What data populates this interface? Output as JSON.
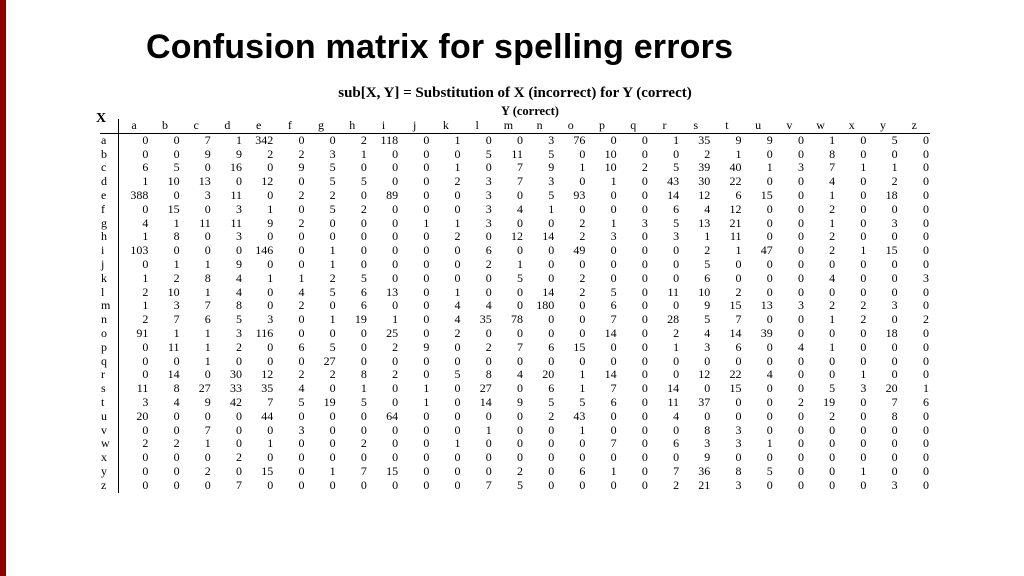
{
  "title": "Confusion matrix for spelling errors",
  "caption": "sub[X, Y] = Substitution of X (incorrect) for Y (correct)",
  "y_axis_label": "Y (correct)",
  "x_axis_label": "X",
  "letters": [
    "a",
    "b",
    "c",
    "d",
    "e",
    "f",
    "g",
    "h",
    "i",
    "j",
    "k",
    "l",
    "m",
    "n",
    "o",
    "p",
    "q",
    "r",
    "s",
    "t",
    "u",
    "v",
    "w",
    "x",
    "y",
    "z"
  ],
  "chart_data": {
    "type": "table",
    "title": "Confusion matrix for spelling errors — sub[X,Y]",
    "row_labels": [
      "a",
      "b",
      "c",
      "d",
      "e",
      "f",
      "g",
      "h",
      "i",
      "j",
      "k",
      "l",
      "m",
      "n",
      "o",
      "p",
      "q",
      "r",
      "s",
      "t",
      "u",
      "v",
      "w",
      "x",
      "y",
      "z"
    ],
    "col_labels": [
      "a",
      "b",
      "c",
      "d",
      "e",
      "f",
      "g",
      "h",
      "i",
      "j",
      "k",
      "l",
      "m",
      "n",
      "o",
      "p",
      "q",
      "r",
      "s",
      "t",
      "u",
      "v",
      "w",
      "x",
      "y",
      "z"
    ],
    "matrix": [
      [
        0,
        0,
        7,
        1,
        342,
        0,
        0,
        2,
        118,
        0,
        1,
        0,
        0,
        3,
        76,
        0,
        0,
        1,
        35,
        9,
        9,
        0,
        1,
        0,
        5,
        0
      ],
      [
        0,
        0,
        9,
        9,
        2,
        2,
        3,
        1,
        0,
        0,
        0,
        5,
        11,
        5,
        0,
        10,
        0,
        0,
        2,
        1,
        0,
        0,
        8,
        0,
        0,
        0
      ],
      [
        6,
        5,
        0,
        16,
        0,
        9,
        5,
        0,
        0,
        0,
        1,
        0,
        7,
        9,
        1,
        10,
        2,
        5,
        39,
        40,
        1,
        3,
        7,
        1,
        1,
        0
      ],
      [
        1,
        10,
        13,
        0,
        12,
        0,
        5,
        5,
        0,
        0,
        2,
        3,
        7,
        3,
        0,
        1,
        0,
        43,
        30,
        22,
        0,
        0,
        4,
        0,
        2,
        0
      ],
      [
        388,
        0,
        3,
        11,
        0,
        2,
        2,
        0,
        89,
        0,
        0,
        3,
        0,
        5,
        93,
        0,
        0,
        14,
        12,
        6,
        15,
        0,
        1,
        0,
        18,
        0
      ],
      [
        0,
        15,
        0,
        3,
        1,
        0,
        5,
        2,
        0,
        0,
        0,
        3,
        4,
        1,
        0,
        0,
        0,
        6,
        4,
        12,
        0,
        0,
        2,
        0,
        0,
        0
      ],
      [
        4,
        1,
        11,
        11,
        9,
        2,
        0,
        0,
        0,
        1,
        1,
        3,
        0,
        0,
        2,
        1,
        3,
        5,
        13,
        21,
        0,
        0,
        1,
        0,
        3,
        0
      ],
      [
        1,
        8,
        0,
        3,
        0,
        0,
        0,
        0,
        0,
        0,
        2,
        0,
        12,
        14,
        2,
        3,
        0,
        3,
        1,
        11,
        0,
        0,
        2,
        0,
        0,
        0
      ],
      [
        103,
        0,
        0,
        0,
        146,
        0,
        1,
        0,
        0,
        0,
        0,
        6,
        0,
        0,
        49,
        0,
        0,
        0,
        2,
        1,
        47,
        0,
        2,
        1,
        15,
        0
      ],
      [
        0,
        1,
        1,
        9,
        0,
        0,
        1,
        0,
        0,
        0,
        0,
        2,
        1,
        0,
        0,
        0,
        0,
        0,
        5,
        0,
        0,
        0,
        0,
        0,
        0,
        0
      ],
      [
        1,
        2,
        8,
        4,
        1,
        1,
        2,
        5,
        0,
        0,
        0,
        0,
        5,
        0,
        2,
        0,
        0,
        0,
        6,
        0,
        0,
        0,
        4,
        0,
        0,
        3
      ],
      [
        2,
        10,
        1,
        4,
        0,
        4,
        5,
        6,
        13,
        0,
        1,
        0,
        0,
        14,
        2,
        5,
        0,
        11,
        10,
        2,
        0,
        0,
        0,
        0,
        0,
        0
      ],
      [
        1,
        3,
        7,
        8,
        0,
        2,
        0,
        6,
        0,
        0,
        4,
        4,
        0,
        180,
        0,
        6,
        0,
        0,
        9,
        15,
        13,
        3,
        2,
        2,
        3,
        0
      ],
      [
        2,
        7,
        6,
        5,
        3,
        0,
        1,
        19,
        1,
        0,
        4,
        35,
        78,
        0,
        0,
        7,
        0,
        28,
        5,
        7,
        0,
        0,
        1,
        2,
        0,
        2
      ],
      [
        91,
        1,
        1,
        3,
        116,
        0,
        0,
        0,
        25,
        0,
        2,
        0,
        0,
        0,
        0,
        14,
        0,
        2,
        4,
        14,
        39,
        0,
        0,
        0,
        18,
        0
      ],
      [
        0,
        11,
        1,
        2,
        0,
        6,
        5,
        0,
        2,
        9,
        0,
        2,
        7,
        6,
        15,
        0,
        0,
        1,
        3,
        6,
        0,
        4,
        1,
        0,
        0,
        0
      ],
      [
        0,
        0,
        1,
        0,
        0,
        0,
        27,
        0,
        0,
        0,
        0,
        0,
        0,
        0,
        0,
        0,
        0,
        0,
        0,
        0,
        0,
        0,
        0,
        0,
        0,
        0
      ],
      [
        0,
        14,
        0,
        30,
        12,
        2,
        2,
        8,
        2,
        0,
        5,
        8,
        4,
        20,
        1,
        14,
        0,
        0,
        12,
        22,
        4,
        0,
        0,
        1,
        0,
        0
      ],
      [
        11,
        8,
        27,
        33,
        35,
        4,
        0,
        1,
        0,
        1,
        0,
        27,
        0,
        6,
        1,
        7,
        0,
        14,
        0,
        15,
        0,
        0,
        5,
        3,
        20,
        1
      ],
      [
        3,
        4,
        9,
        42,
        7,
        5,
        19,
        5,
        0,
        1,
        0,
        14,
        9,
        5,
        5,
        6,
        0,
        11,
        37,
        0,
        0,
        2,
        19,
        0,
        7,
        6
      ],
      [
        20,
        0,
        0,
        0,
        44,
        0,
        0,
        0,
        64,
        0,
        0,
        0,
        0,
        2,
        43,
        0,
        0,
        4,
        0,
        0,
        0,
        0,
        2,
        0,
        8,
        0
      ],
      [
        0,
        0,
        7,
        0,
        0,
        3,
        0,
        0,
        0,
        0,
        0,
        1,
        0,
        0,
        1,
        0,
        0,
        0,
        8,
        3,
        0,
        0,
        0,
        0,
        0,
        0
      ],
      [
        2,
        2,
        1,
        0,
        1,
        0,
        0,
        2,
        0,
        0,
        1,
        0,
        0,
        0,
        0,
        7,
        0,
        6,
        3,
        3,
        1,
        0,
        0,
        0,
        0,
        0
      ],
      [
        0,
        0,
        0,
        2,
        0,
        0,
        0,
        0,
        0,
        0,
        0,
        0,
        0,
        0,
        0,
        0,
        0,
        0,
        9,
        0,
        0,
        0,
        0,
        0,
        0,
        0
      ],
      [
        0,
        0,
        2,
        0,
        15,
        0,
        1,
        7,
        15,
        0,
        0,
        0,
        2,
        0,
        6,
        1,
        0,
        7,
        36,
        8,
        5,
        0,
        0,
        1,
        0,
        0
      ],
      [
        0,
        0,
        0,
        7,
        0,
        0,
        0,
        0,
        0,
        0,
        0,
        7,
        5,
        0,
        0,
        0,
        0,
        2,
        21,
        3,
        0,
        0,
        0,
        0,
        3,
        0
      ]
    ]
  }
}
